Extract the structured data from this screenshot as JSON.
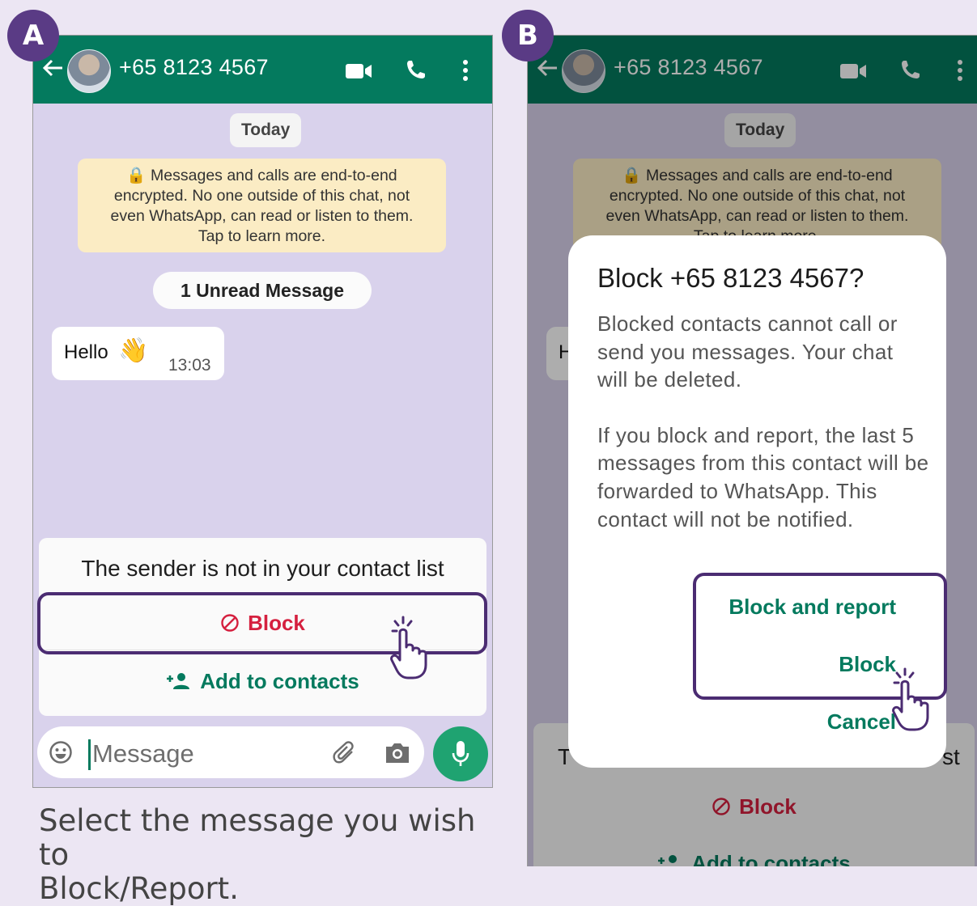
{
  "panel_a": {
    "badge": "A",
    "header": {
      "contact": "+65 8123 4567",
      "icons": [
        "back-arrow-icon",
        "video-call-icon",
        "voice-call-icon",
        "more-vertical-icon"
      ]
    },
    "date_chip": "Today",
    "encryption_notice": {
      "line1": "Messages and calls are end-to-end",
      "line2": "encrypted. No one outside of this chat, not",
      "line3": "even WhatsApp, can read or listen to them.",
      "line4": "Tap to learn more."
    },
    "unread_label": "1 Unread Message",
    "message": {
      "text": "Hello",
      "emoji": "👋",
      "time": "13:03"
    },
    "sender_card": {
      "text": "The sender is not in your contact list",
      "block_label": "Block",
      "add_label": "Add to contacts"
    },
    "input": {
      "placeholder": "Message"
    },
    "caption_line1": "Select the message you wish to",
    "caption_line2": "Block/Report."
  },
  "panel_b": {
    "badge": "B",
    "header": {
      "contact": "+65 8123 4567"
    },
    "date_chip": "Today",
    "encryption_notice": {
      "line1": "Messages and calls are end-to-end",
      "line2": "encrypted. No one outside of this chat, not",
      "line3": "even WhatsApp, can read or listen to them.",
      "line4": "Tap to learn more."
    },
    "dialog": {
      "title": "Block +65 8123 4567?",
      "body1": "Blocked contacts cannot call or send you messages. Your chat will be deleted.",
      "body2": "If you block and report, the last 5 messages from this contact will be forwarded to WhatsApp. This contact will not be notified.",
      "block_and_report": "Block and report",
      "block": "Block",
      "cancel": "Cancel"
    },
    "behind": {
      "bubble_fragment": "H",
      "card_left_fragment": "T",
      "card_right_fragment": "st",
      "block_label": "Block",
      "add_label": "Add to contacts"
    }
  },
  "colors": {
    "header_green": "#047a5e",
    "block_red": "#d5203f",
    "highlight_purple": "#4b2c72",
    "badge_purple": "#5a3b85"
  }
}
